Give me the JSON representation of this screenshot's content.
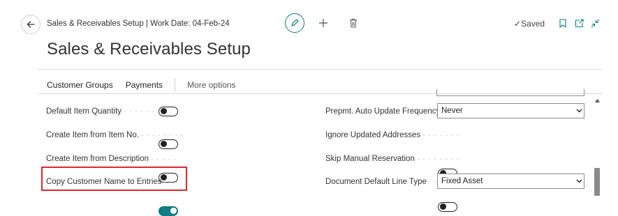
{
  "header": {
    "breadcrumb": "Sales & Receivables Setup | Work Date: 04-Feb-24",
    "title": "Sales & Receivables Setup",
    "status": "✓Saved"
  },
  "actions": {
    "items": [
      "Customer Groups",
      "Payments"
    ],
    "more": "More options"
  },
  "left_fields": [
    {
      "label": "Default Item Quantity",
      "dots": "· · · · · · · · · ·",
      "value": false
    },
    {
      "label": "Create Item from Item No.",
      "dots": "· · · · · · · ·",
      "value": false
    },
    {
      "label": "Create Item from Description",
      "dots": "· · · · ·",
      "value": false
    },
    {
      "label": "Copy Customer Name to Entries",
      "dots": "· · ·",
      "value": true
    }
  ],
  "right_fields": [
    {
      "label": "Prepmt. Auto Update Frequency",
      "dots": "· · ·",
      "type": "select",
      "value": "Never"
    },
    {
      "label": "Ignore Updated Addresses",
      "dots": "· · · · · · ·",
      "type": "toggle",
      "value": false
    },
    {
      "label": "Skip Manual Reservation",
      "dots": "· · · · · · · ·",
      "type": "toggle",
      "value": false
    },
    {
      "label": "Document Default Line Type",
      "dots": "· · · · ·",
      "type": "select",
      "value": "Fixed Asset"
    }
  ],
  "colors": {
    "accent": "#0f7d82",
    "highlight": "#e0262b"
  },
  "icons": [
    "back-arrow-icon",
    "edit-pencil-icon",
    "plus-icon",
    "trash-icon",
    "bookmark-icon",
    "open-new-window-icon",
    "collapse-icon",
    "chevron-down-icon",
    "scroll-up-icon"
  ]
}
